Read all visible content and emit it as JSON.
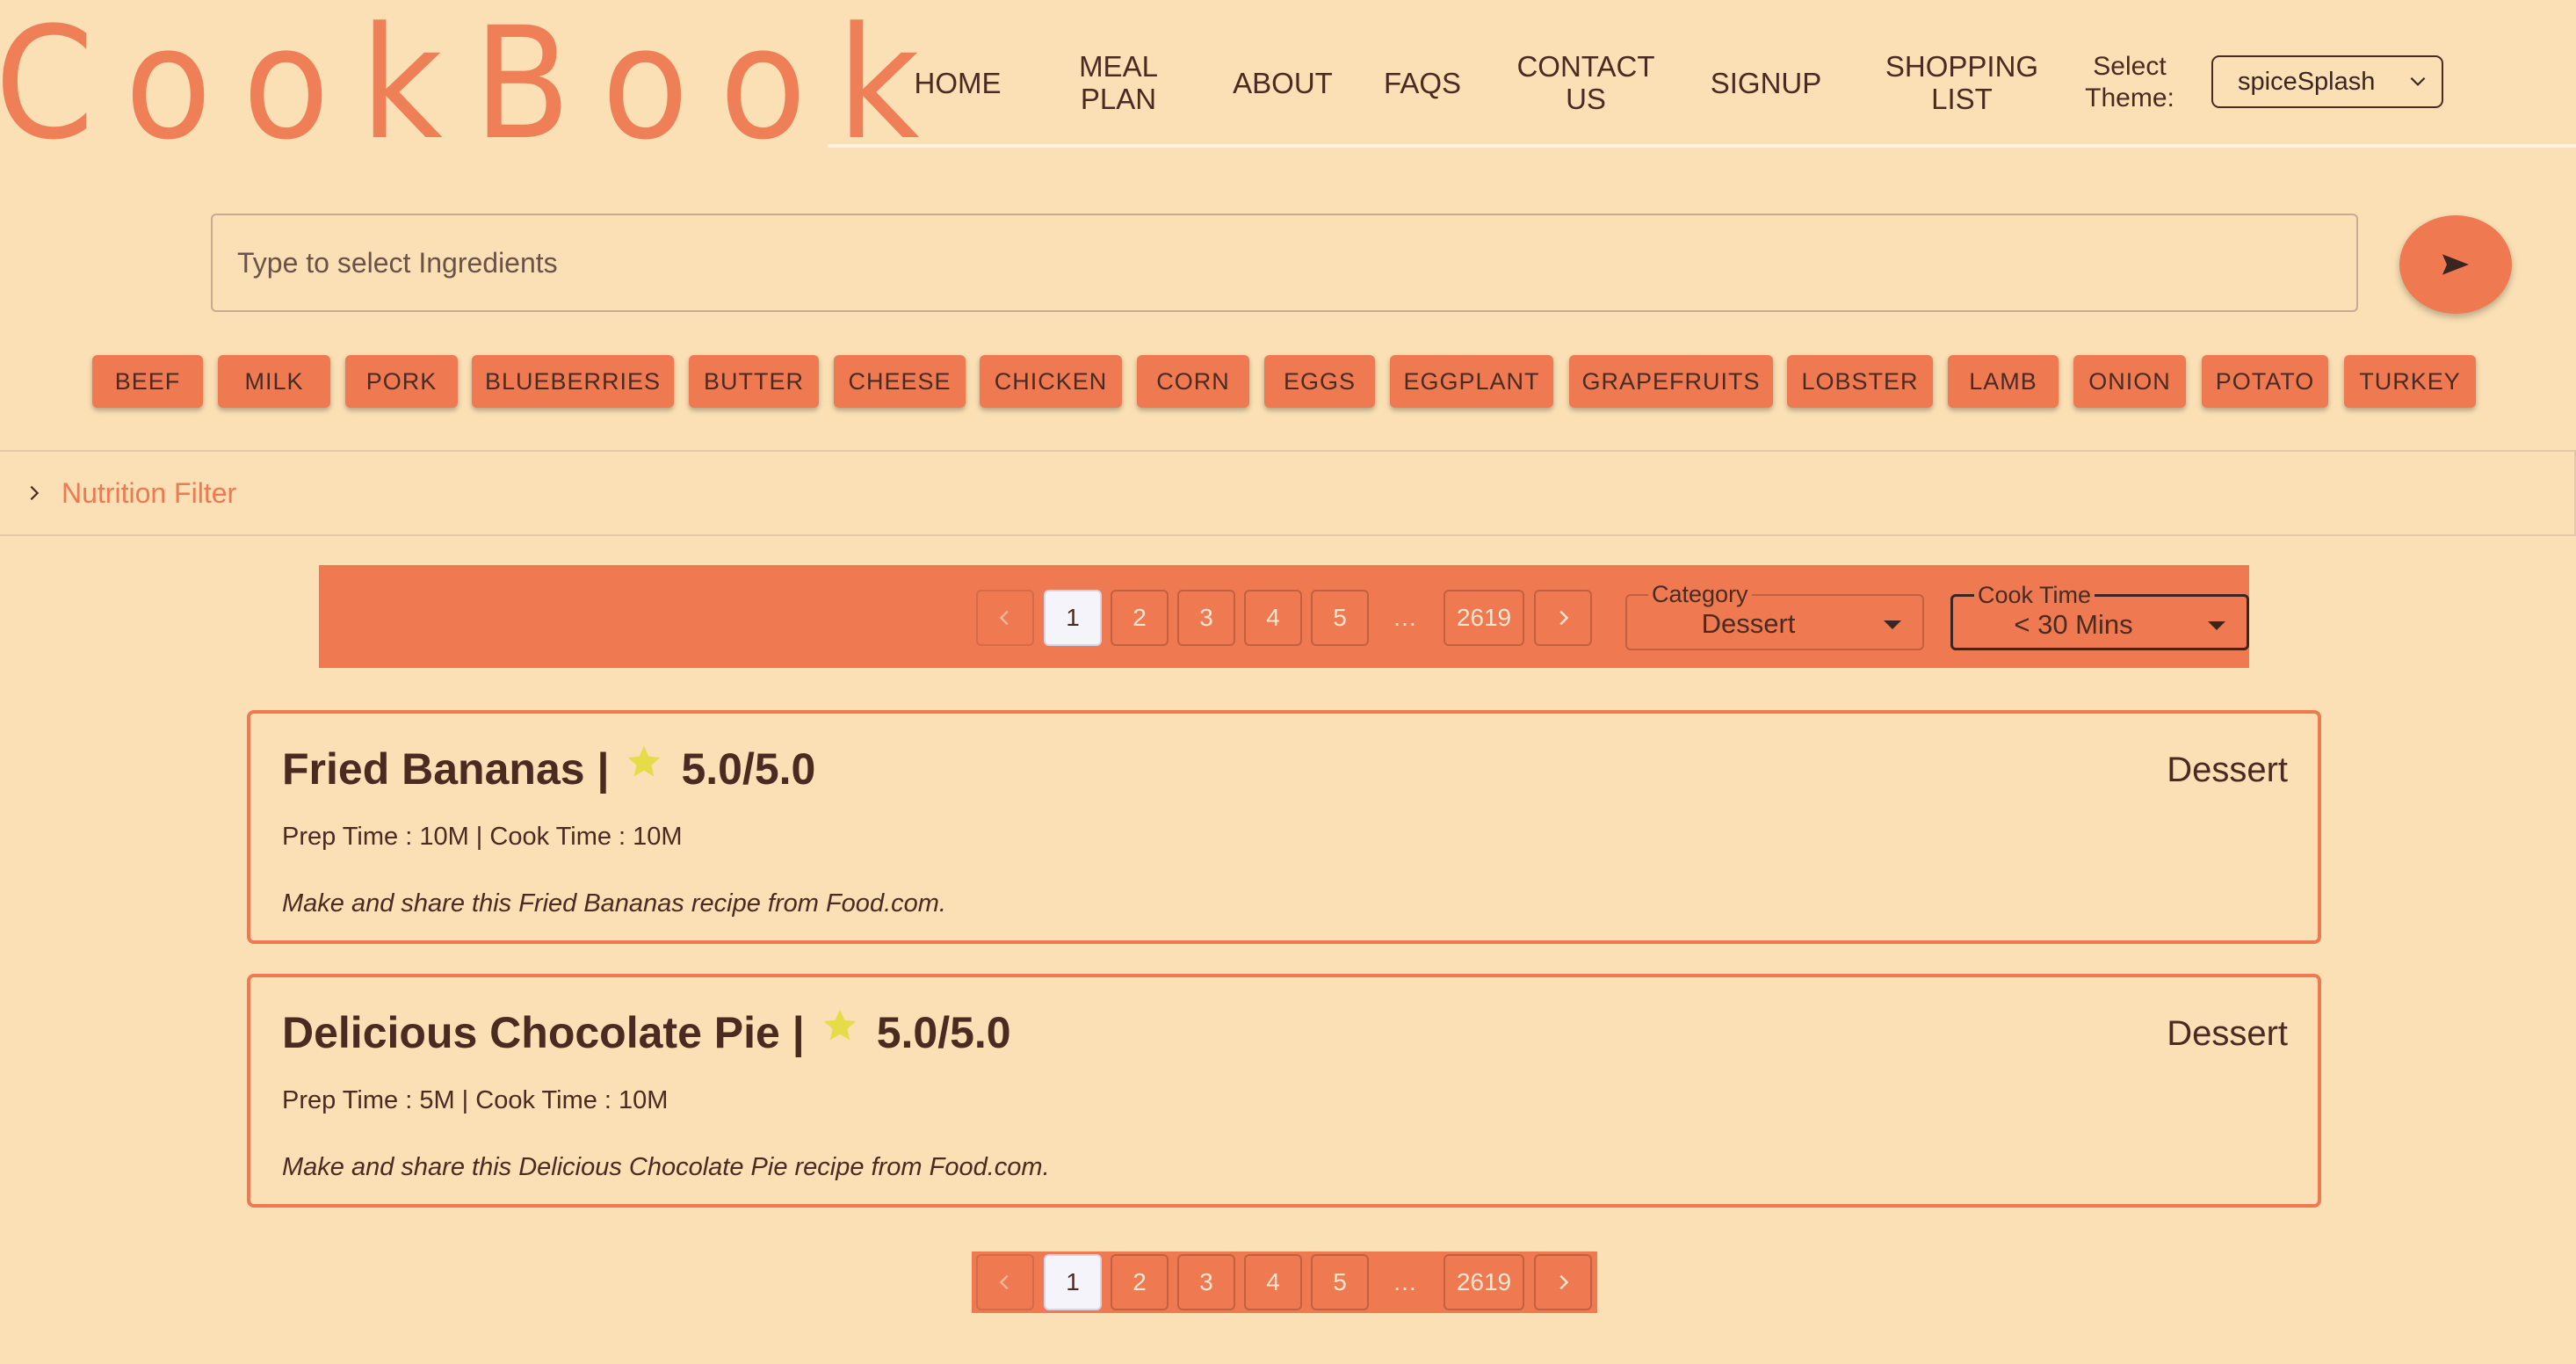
{
  "logo": "CookBook",
  "nav": {
    "home": "HOME",
    "meal_plan": "MEAL PLAN",
    "about": "ABOUT",
    "faqs": "FAQS",
    "contact_us": "CONTACT US",
    "signup": "SIGNUP",
    "shopping_list": "SHOPPING LIST",
    "theme_label": "Select Theme:",
    "theme_value": "spiceSplash"
  },
  "search": {
    "placeholder": "Type to select Ingredients"
  },
  "ingredients": [
    "BEEF",
    "MILK",
    "PORK",
    "BLUEBERRIES",
    "BUTTER",
    "CHEESE",
    "CHICKEN",
    "CORN",
    "EGGS",
    "EGGPLANT",
    "GRAPEFRUITS",
    "LOBSTER",
    "LAMB",
    "ONION",
    "POTATO",
    "TURKEY"
  ],
  "nutrition_filter": "Nutrition Filter",
  "pagination": {
    "pages": [
      "1",
      "2",
      "3",
      "4",
      "5"
    ],
    "ellipsis": "…",
    "last": "2619",
    "current": "1"
  },
  "filters": {
    "category_label": "Category",
    "category_value": "Dessert",
    "cook_time_label": "Cook Time",
    "cook_time_value": "< 30 Mins"
  },
  "recipes": [
    {
      "title": "Fried Bananas |",
      "rating": "5.0/5.0",
      "category": "Dessert",
      "times": "Prep Time : 10M | Cook Time : 10M",
      "description": "Make and share this Fried Bananas recipe from Food.com."
    },
    {
      "title": "Delicious Chocolate Pie |",
      "rating": "5.0/5.0",
      "category": "Dessert",
      "times": "Prep Time : 5M | Cook Time : 10M",
      "description": "Make and share this Delicious Chocolate Pie recipe from Food.com."
    }
  ],
  "colors": {
    "accent": "#ef7a52",
    "background": "#fae0b4",
    "text": "#4a2b22",
    "star": "#e6dc4a"
  }
}
